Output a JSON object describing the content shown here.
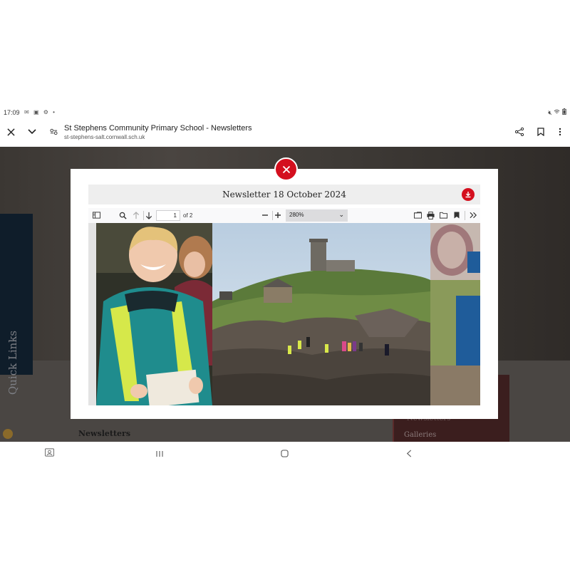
{
  "status_bar": {
    "time": "17:09",
    "notification_icons": [
      "mail-icon",
      "contacts-icon",
      "settings-icon"
    ],
    "system_icons": [
      "mute-icon",
      "wifi-icon",
      "battery-icon"
    ]
  },
  "browser": {
    "title": "St Stephens Community Primary School - Newsletters",
    "url": "st-stephens-salt.cornwall.sch.uk",
    "icons": [
      "close-icon",
      "chevron-down-icon",
      "site-settings-icon",
      "share-icon",
      "bookmark-icon",
      "more-icon"
    ]
  },
  "background_page": {
    "quick_links": "Quick Links",
    "heading": "Newsletters",
    "menu": [
      "Newsletters",
      "Galleries"
    ]
  },
  "modal": {
    "doc_title": "Newsletter 18 October 2024",
    "pdf_toolbar": {
      "page_current": "1",
      "page_count": "of 2",
      "zoom": "280%"
    }
  },
  "colors": {
    "accent_red": "#d40f1e",
    "page_bg_dark": "#2e2a27",
    "quick_links_bg": "#0f1d2a"
  },
  "nav_bar": {
    "icons": [
      "screenshot-icon",
      "recents-icon",
      "home-icon",
      "back-icon"
    ]
  }
}
